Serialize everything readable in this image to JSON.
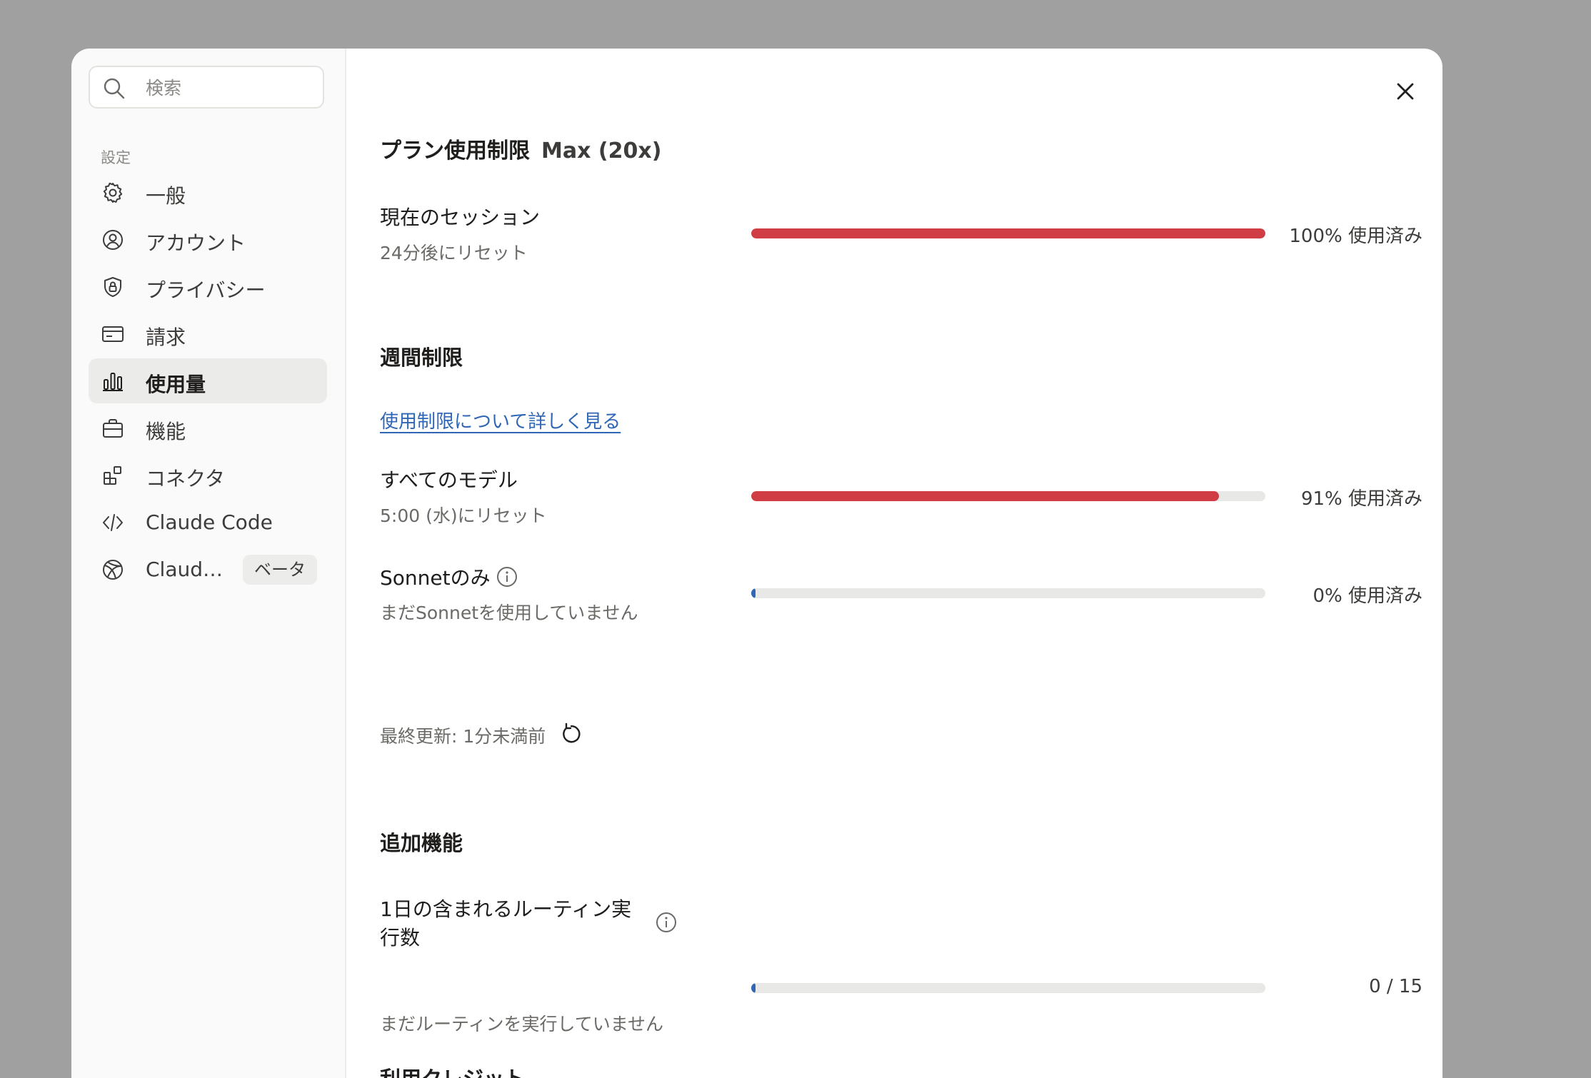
{
  "sidebar": {
    "search_placeholder": "検索",
    "section_label": "設定",
    "items": [
      {
        "label": "一般",
        "icon": "gear-icon"
      },
      {
        "label": "アカウント",
        "icon": "user-circle-icon"
      },
      {
        "label": "プライバシー",
        "icon": "shield-lock-icon"
      },
      {
        "label": "請求",
        "icon": "credit-card-icon"
      },
      {
        "label": "使用量",
        "icon": "bar-chart-icon",
        "active": true
      },
      {
        "label": "機能",
        "icon": "briefcase-icon"
      },
      {
        "label": "コネクタ",
        "icon": "blocks-icon"
      },
      {
        "label": "Claude Code",
        "icon": "code-icon"
      },
      {
        "label": "Claud…",
        "icon": "globe-icon",
        "badge": "ベータ"
      }
    ]
  },
  "main": {
    "title": "プラン使用制限",
    "plan": "Max (20x)",
    "session": {
      "title": "現在のセッション",
      "sub": "24分後にリセット",
      "percent_text": "100% 使用済み",
      "fraction": 1.0
    },
    "weekly_heading": "週間制限",
    "learn_link": "使用制限について詳しく見る",
    "all_models": {
      "title": "すべてのモデル",
      "sub": "5:00 (水)にリセット",
      "percent_text": "91% 使用済み",
      "fraction": 0.91
    },
    "sonnet": {
      "title": "Sonnetのみ",
      "sub": "まだSonnetを使用していません",
      "percent_text": "0% 使用済み",
      "fraction": 0.0
    },
    "last_updated": "最終更新: 1分未満前",
    "extra_heading": "追加機能",
    "routines": {
      "title_line1": "1日の含まれるルーティン実",
      "title_line2": "行数",
      "sub": "まだルーティンを実行していません",
      "count_text": "0 / 15",
      "fraction": 0.0
    },
    "credits_heading": "利用クレジット"
  },
  "colors": {
    "red": "#d13d45",
    "blue": "#2f66b5",
    "track": "#e8e8e6"
  }
}
